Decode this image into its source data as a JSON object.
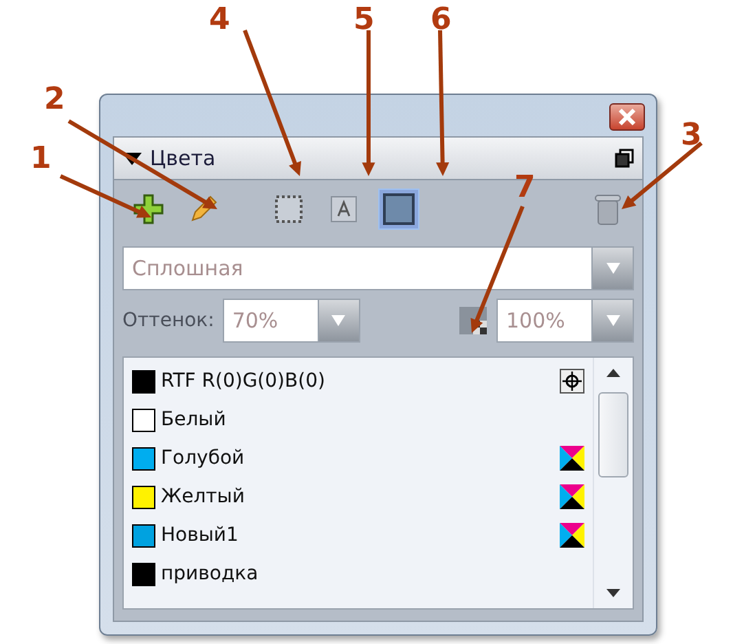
{
  "panel": {
    "title": "Цвета",
    "expanded": true
  },
  "toolbar": {
    "modes": [
      {
        "kind": "border",
        "selected": false
      },
      {
        "kind": "text",
        "selected": false
      },
      {
        "kind": "fill",
        "selected": true
      }
    ]
  },
  "fill_type": {
    "value": "Сплошная"
  },
  "shade": {
    "label": "Оттенок:",
    "value": "70%"
  },
  "opacity": {
    "value": "100%"
  },
  "colors": [
    {
      "name": "RTF R(0)G(0)B(0)",
      "color": "#000000",
      "kind": "registration"
    },
    {
      "name": "Белый",
      "color": "#ffffff",
      "kind": "plain"
    },
    {
      "name": "Голубой",
      "color": "#00adef",
      "kind": "cmyk"
    },
    {
      "name": "Желтый",
      "color": "#fff200",
      "kind": "cmyk"
    },
    {
      "name": "Новый1",
      "color": "#00a2e0",
      "kind": "cmyk"
    },
    {
      "name": "приводка",
      "color": "#000000",
      "kind": "plain"
    }
  ],
  "annotations": [
    "1",
    "2",
    "3",
    "4",
    "5",
    "6",
    "7"
  ]
}
